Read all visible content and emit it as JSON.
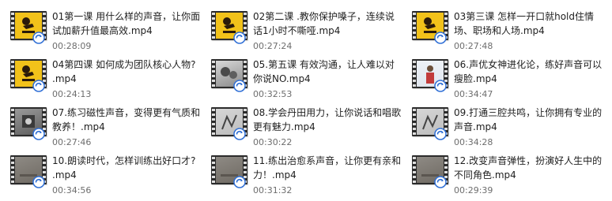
{
  "colors": {
    "filename_text": "#1e1e1e",
    "duration_text": "#6d6d6d",
    "film_strip": "#2b2b2b",
    "thumb_yellow": "#f2c21a",
    "badge_blue": "#2f6fd6"
  },
  "files": [
    {
      "name_line1": "01第一课 用什么样的声音，让你面",
      "name_line2": "试加薪升值最高效.mp4",
      "duration": "00:28:09",
      "thumb": "yellow",
      "icon": "video-file-icon"
    },
    {
      "name_line1": "02第二课 .教你保护嗓子，连续说",
      "name_line2": "话1小时不嘶哑.mp4",
      "duration": "00:27:24",
      "thumb": "yellow",
      "icon": "video-file-icon"
    },
    {
      "name_line1": "03第三课 怎样一开口就hold住情",
      "name_line2": "场、职场和人场.mp4",
      "duration": "00:27:48",
      "thumb": "yellow",
      "icon": "video-file-icon"
    },
    {
      "name_line1": "04第四课 如何成为团队核心人物?",
      "name_line2": ".mp4",
      "duration": "00:24:13",
      "thumb": "yellow",
      "icon": "video-file-icon"
    },
    {
      "name_line1": "05.第五课 有效沟通，让人难以对",
      "name_line2": "你说NO.mp4",
      "duration": "00:32:53",
      "thumb": "photo",
      "icon": "video-file-icon"
    },
    {
      "name_line1": "06.声优女神进化论，练好声音可以",
      "name_line2": "瘦脸.mp4",
      "duration": "00:34:47",
      "thumb": "person",
      "icon": "video-file-icon"
    },
    {
      "name_line1": "07.练习磁性声音，变得更有气质和",
      "name_line2": "教养！.mp4",
      "duration": "00:27:46",
      "thumb": "dark",
      "icon": "video-file-icon"
    },
    {
      "name_line1": "08.学会丹田用力，让你说话和唱歌",
      "name_line2": "更有魅力.mp4",
      "duration": "00:30:22",
      "thumb": "sketch",
      "icon": "video-file-icon"
    },
    {
      "name_line1": "09.打通三腔共鸣，让你拥有专业的",
      "name_line2": "声音.mp4",
      "duration": "00:34:28",
      "thumb": "sketch",
      "icon": "video-file-icon"
    },
    {
      "name_line1": "10.朗读时代，怎样训练出好口才?",
      "name_line2": ".mp4",
      "duration": "00:34:56",
      "thumb": "plain",
      "icon": "video-file-icon"
    },
    {
      "name_line1": "11.练出治愈系声音，让你更有亲和",
      "name_line2": "力！.mp4",
      "duration": "00:31:32",
      "thumb": "plain",
      "icon": "video-file-icon"
    },
    {
      "name_line1": "12.改变声音弹性，扮演好人生中的",
      "name_line2": "不同角色.mp4",
      "duration": "00:29:39",
      "thumb": "plain",
      "icon": "video-file-icon"
    }
  ]
}
